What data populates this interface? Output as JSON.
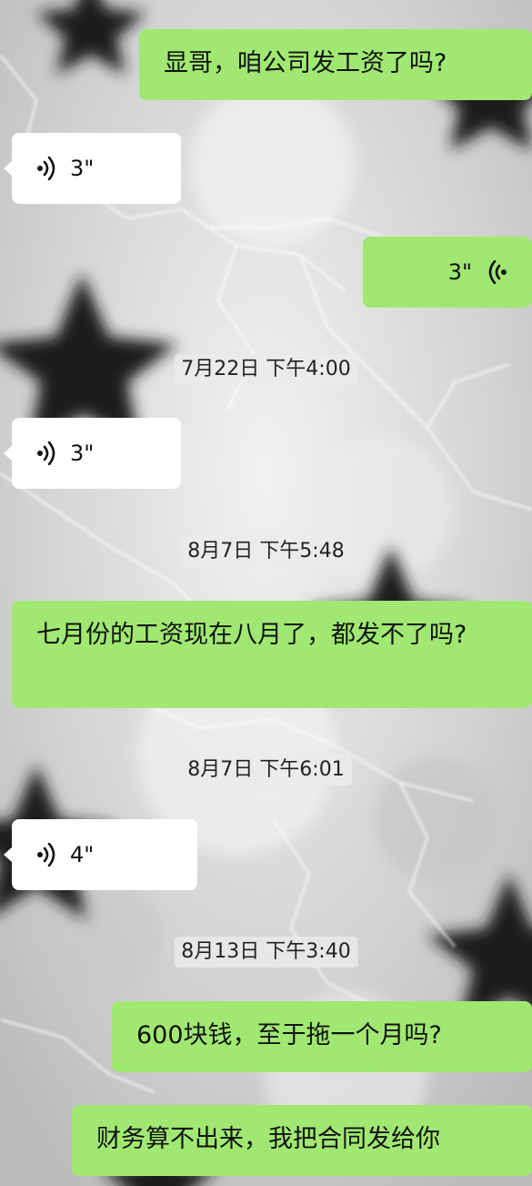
{
  "chat": {
    "messages": [
      {
        "side": "out",
        "kind": "text",
        "text": "显哥，咱公司发工资了吗?"
      },
      {
        "side": "in",
        "kind": "voice",
        "duration": "3\"",
        "icon": "voice-wave-icon"
      },
      {
        "side": "out",
        "kind": "voice",
        "duration": "3\"",
        "icon": "voice-wave-icon"
      },
      {
        "kind": "timestamp",
        "text": "7月22日 下午4:00"
      },
      {
        "side": "in",
        "kind": "voice",
        "duration": "3\"",
        "icon": "voice-wave-icon"
      },
      {
        "kind": "timestamp",
        "text": "8月7日 下午5:48"
      },
      {
        "side": "out",
        "kind": "text",
        "text": "七月份的工资现在八月了，都发不了吗?"
      },
      {
        "kind": "timestamp",
        "text": "8月7日 下午6:01"
      },
      {
        "side": "in",
        "kind": "voice",
        "duration": "4\"",
        "icon": "voice-wave-icon"
      },
      {
        "kind": "timestamp",
        "text": "8月13日 下午3:40"
      },
      {
        "side": "out",
        "kind": "text",
        "text": "600块钱，至于拖一个月吗?"
      },
      {
        "side": "out",
        "kind": "text",
        "text": "财务算不出来，我把合同发给你"
      }
    ]
  },
  "colors": {
    "outgoing_bubble": "#a0e872",
    "incoming_bubble": "#ffffff",
    "timestamp_bg": "#ebebeb",
    "background": "#d9d9d9"
  }
}
